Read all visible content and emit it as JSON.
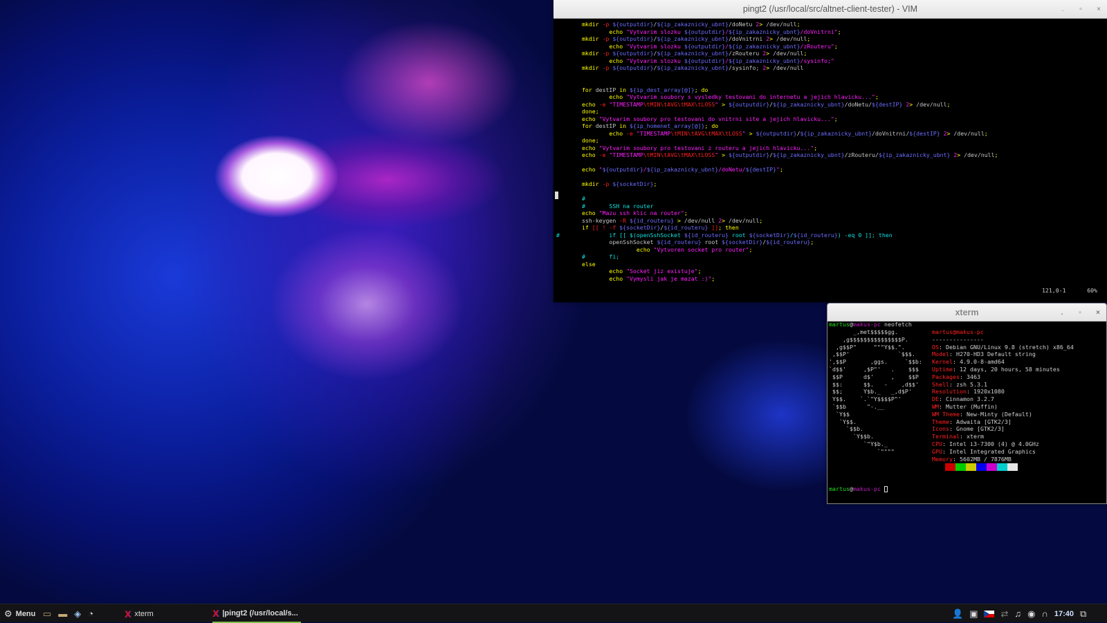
{
  "colors": {
    "y": "#ffff00",
    "r": "#ff2020",
    "m": "#ff20ff",
    "b": "#6c6cff",
    "w": "#c8c8c8",
    "c": "#10e0e0"
  },
  "vim": {
    "title": "pingt2 (/usr/local/src/altnet-client-tester) - VIM",
    "buttons": {
      "minimize": ".",
      "maximize": "▫",
      "close": "×"
    },
    "status_position": "121,0-1",
    "status_percent": "60%",
    "lines": [
      {
        "s": "",
        "t": [
          [
            "y",
            "mkdir "
          ],
          [
            "r",
            "-p "
          ],
          [
            "b",
            "${outputdir}"
          ],
          [
            "w",
            "/"
          ],
          [
            "b",
            "${ip_zakaznicky_ubnt}"
          ],
          [
            "w",
            "/doNetu "
          ],
          [
            "m",
            "2"
          ],
          [
            "y",
            ">"
          ],
          [
            "w",
            " /dev/null"
          ],
          [
            "y",
            ";"
          ]
        ]
      },
      {
        "s": "",
        "t": [
          [
            "y",
            "        echo "
          ],
          [
            "m",
            "\"Vytvarim slozku "
          ],
          [
            "b",
            "${outputdir}"
          ],
          [
            "m",
            "/"
          ],
          [
            "b",
            "${ip_zakaznicky_ubnt}"
          ],
          [
            "m",
            "/doVnitrni\""
          ],
          [
            "y",
            ";"
          ]
        ]
      },
      {
        "s": "",
        "t": [
          [
            "y",
            "mkdir "
          ],
          [
            "r",
            "-p "
          ],
          [
            "b",
            "${outputdir}"
          ],
          [
            "w",
            "/"
          ],
          [
            "b",
            "${ip_zakaznicky_ubnt}"
          ],
          [
            "w",
            "/doVnitrni "
          ],
          [
            "m",
            "2"
          ],
          [
            "y",
            ">"
          ],
          [
            "w",
            " /dev/null"
          ],
          [
            "y",
            ";"
          ]
        ]
      },
      {
        "s": "",
        "t": [
          [
            "y",
            "        echo "
          ],
          [
            "m",
            "\"Vytvarim slozku "
          ],
          [
            "b",
            "${outputdir}"
          ],
          [
            "m",
            "/"
          ],
          [
            "b",
            "${ip_zakaznicky_ubnt}"
          ],
          [
            "m",
            "/zRouteru\""
          ],
          [
            "y",
            ";"
          ]
        ]
      },
      {
        "s": "",
        "t": [
          [
            "y",
            "mkdir "
          ],
          [
            "r",
            "-p "
          ],
          [
            "b",
            "${outputdir}"
          ],
          [
            "w",
            "/"
          ],
          [
            "b",
            "${ip_zakaznicky_ubnt}"
          ],
          [
            "w",
            "/zRouteru "
          ],
          [
            "m",
            "2"
          ],
          [
            "y",
            ">"
          ],
          [
            "w",
            " /dev/null"
          ],
          [
            "y",
            ";"
          ]
        ]
      },
      {
        "s": "",
        "t": [
          [
            "y",
            "        echo "
          ],
          [
            "m",
            "\"Vytvarim slozku "
          ],
          [
            "b",
            "${outputdir}"
          ],
          [
            "m",
            "/"
          ],
          [
            "b",
            "${ip_zakaznicky_ubnt}"
          ],
          [
            "m",
            "/sysinfo;\""
          ]
        ]
      },
      {
        "s": "",
        "t": [
          [
            "y",
            "mkdir "
          ],
          [
            "r",
            "-p "
          ],
          [
            "b",
            "${outputdir}"
          ],
          [
            "w",
            "/"
          ],
          [
            "b",
            "${ip_zakaznicky_ubnt}"
          ],
          [
            "w",
            "/sysinfo; "
          ],
          [
            "m",
            "2"
          ],
          [
            "y",
            ">"
          ],
          [
            "w",
            " /dev/null"
          ]
        ]
      },
      {
        "s": "",
        "t": []
      },
      {
        "s": "",
        "t": []
      },
      {
        "s": "",
        "t": [
          [
            "y",
            "for "
          ],
          [
            "w",
            "destIP "
          ],
          [
            "y",
            "in "
          ],
          [
            "b",
            "${ip_dest_array[@]}"
          ],
          [
            "y",
            "; do"
          ]
        ]
      },
      {
        "s": "",
        "t": [
          [
            "y",
            "        echo "
          ],
          [
            "m",
            "\"Vytvarim soubory s vysledky testovani do internetu a jejich hlavicku...\""
          ],
          [
            "y",
            ";"
          ]
        ]
      },
      {
        "s": "",
        "t": [
          [
            "y",
            "echo "
          ],
          [
            "r",
            "-e "
          ],
          [
            "m",
            "\"TIMESTAMP"
          ],
          [
            "r",
            "\\tMIN\\tAVG\\tMAX\\tLOSS"
          ],
          [
            "m",
            "\""
          ],
          [
            "y",
            " > "
          ],
          [
            "b",
            "${outputdir}"
          ],
          [
            "w",
            "/"
          ],
          [
            "b",
            "${ip_zakaznicky_ubnt}"
          ],
          [
            "w",
            "/doNetu/"
          ],
          [
            "b",
            "${destIP}"
          ],
          [
            "m",
            " 2"
          ],
          [
            "y",
            ">"
          ],
          [
            "w",
            " /dev/null"
          ],
          [
            "y",
            ";"
          ]
        ]
      },
      {
        "s": "",
        "t": [
          [
            "y",
            "done;"
          ]
        ]
      },
      {
        "s": "",
        "t": [
          [
            "y",
            "echo "
          ],
          [
            "m",
            "\"Vytvarim soubory pro testovani do vnitrni site a jejich hlavicku...\""
          ],
          [
            "y",
            ";"
          ]
        ]
      },
      {
        "s": "",
        "t": [
          [
            "y",
            "for "
          ],
          [
            "w",
            "destIP "
          ],
          [
            "y",
            "in "
          ],
          [
            "b",
            "${ip_homenet_array[@]}"
          ],
          [
            "y",
            "; do"
          ]
        ]
      },
      {
        "s": "",
        "t": [
          [
            "y",
            "        echo "
          ],
          [
            "r",
            "-e "
          ],
          [
            "m",
            "\"TIMESTAMP"
          ],
          [
            "r",
            "\\tMIN\\tAVG\\tMAX\\tLOSS"
          ],
          [
            "m",
            "\""
          ],
          [
            "y",
            " > "
          ],
          [
            "b",
            "${outputdir}"
          ],
          [
            "w",
            "/"
          ],
          [
            "b",
            "${ip_zakaznicky_ubnt}"
          ],
          [
            "w",
            "/doVnitrni/"
          ],
          [
            "b",
            "${destIP}"
          ],
          [
            "m",
            " 2"
          ],
          [
            "y",
            ">"
          ],
          [
            "w",
            " /dev/null"
          ],
          [
            "y",
            ";"
          ]
        ]
      },
      {
        "s": "",
        "t": [
          [
            "y",
            "done;"
          ]
        ]
      },
      {
        "s": "",
        "t": [
          [
            "y",
            "echo "
          ],
          [
            "m",
            "\"Vytvarim soubory pro testovani z routeru a jejich hlavicku...\""
          ],
          [
            "y",
            ";"
          ]
        ]
      },
      {
        "s": "",
        "t": [
          [
            "y",
            "echo "
          ],
          [
            "r",
            "-e "
          ],
          [
            "m",
            "\"TIMESTAMP"
          ],
          [
            "r",
            "\\tMIN\\tAVG\\tMAX\\tLOSS"
          ],
          [
            "m",
            "\""
          ],
          [
            "y",
            " > "
          ],
          [
            "b",
            "${outputdir}"
          ],
          [
            "w",
            "/"
          ],
          [
            "b",
            "${ip_zakaznicky_ubnt}"
          ],
          [
            "w",
            "/zRouteru/"
          ],
          [
            "b",
            "${ip_zakaznicky_ubnt}"
          ],
          [
            "m",
            " 2"
          ],
          [
            "y",
            ">"
          ],
          [
            "w",
            " /dev/null"
          ],
          [
            "y",
            ";"
          ]
        ]
      },
      {
        "s": "",
        "t": []
      },
      {
        "s": "",
        "t": [
          [
            "y",
            "echo "
          ],
          [
            "m",
            "\""
          ],
          [
            "b",
            "${outputdir}"
          ],
          [
            "m",
            "/"
          ],
          [
            "b",
            "${ip_zakaznicky_ubnt}"
          ],
          [
            "m",
            "/doNetu/"
          ],
          [
            "b",
            "${destIP}"
          ],
          [
            "m",
            "\""
          ],
          [
            "y",
            ";"
          ]
        ]
      },
      {
        "s": "",
        "t": []
      },
      {
        "s": "",
        "t": [
          [
            "y",
            "mkdir "
          ],
          [
            "r",
            "-p "
          ],
          [
            "b",
            "${socketDir}"
          ],
          [
            "y",
            ";"
          ]
        ]
      },
      {
        "s": "",
        "t": []
      },
      {
        "s": "",
        "t": [
          [
            "c",
            "#"
          ]
        ]
      },
      {
        "s": "",
        "t": [
          [
            "c",
            "#       SSH na router"
          ]
        ]
      },
      {
        "s": "",
        "t": [
          [
            "y",
            "echo "
          ],
          [
            "m",
            "\"Mazu ssh klic na router\""
          ],
          [
            "y",
            ";"
          ]
        ]
      },
      {
        "s": "",
        "t": [
          [
            "w",
            "ssh-keygen "
          ],
          [
            "r",
            "-R "
          ],
          [
            "b",
            "${id_routeru}"
          ],
          [
            "y",
            " > "
          ],
          [
            "w",
            "/dev/null "
          ],
          [
            "m",
            "2"
          ],
          [
            "y",
            ">"
          ],
          [
            "w",
            " /dev/null"
          ],
          [
            "y",
            ";"
          ]
        ]
      },
      {
        "s": "",
        "t": [
          [
            "y",
            "if "
          ],
          [
            "r",
            "[[ ! -f "
          ],
          [
            "b",
            "${socketDir}"
          ],
          [
            "w",
            "/"
          ],
          [
            "b",
            "${id_routeru}"
          ],
          [
            "r",
            " ]]"
          ],
          [
            "y",
            "; then"
          ]
        ]
      },
      {
        "s": "#",
        "t": [
          [
            "c",
            "        if [[ $(openSshSocket "
          ],
          [
            "b",
            "${id_routeru}"
          ],
          [
            "c",
            " root "
          ],
          [
            "b",
            "${socketDir}"
          ],
          [
            "c",
            "/"
          ],
          [
            "b",
            "${id_routeru}"
          ],
          [
            "c",
            ") -eq 0 ]]; then"
          ]
        ]
      },
      {
        "s": "",
        "t": [
          [
            "w",
            "        openSshSocket "
          ],
          [
            "b",
            "${id_routeru}"
          ],
          [
            "w",
            " root "
          ],
          [
            "b",
            "${socketDir}"
          ],
          [
            "w",
            "/"
          ],
          [
            "b",
            "${id_routeru}"
          ],
          [
            "y",
            ";"
          ]
        ]
      },
      {
        "s": "",
        "t": [
          [
            "y",
            "                echo "
          ],
          [
            "m",
            "\"Vytvoren socket pro router\""
          ],
          [
            "y",
            ";"
          ]
        ]
      },
      {
        "s": "",
        "t": [
          [
            "c",
            "#       fi;"
          ]
        ]
      },
      {
        "s": "",
        "t": [
          [
            "y",
            "else"
          ]
        ]
      },
      {
        "s": "",
        "t": [
          [
            "y",
            "        echo "
          ],
          [
            "m",
            "\"Socket jiz existuje\""
          ],
          [
            "y",
            ";"
          ]
        ]
      },
      {
        "s": "",
        "t": [
          [
            "y",
            "        echo "
          ],
          [
            "m",
            "\"Vymysli jak je mazat :)\""
          ],
          [
            "y",
            ";"
          ]
        ]
      }
    ]
  },
  "xterm": {
    "title": "xterm",
    "buttons": {
      "minimize": ".",
      "maximize": "▫",
      "close": "×"
    },
    "prompt_user": "martus",
    "prompt_at": "@",
    "prompt_host": "makus-pc",
    "command": " neofetch",
    "logo": [
      "       _,met$$$$$gg.",
      "    ,g$$$$$$$$$$$$$$$P.",
      "  ,g$$P\"     \"\"\"Y$$.\".",
      " ,$$P'              `$$$.",
      "',$$P       ,ggs.     `$$b:",
      "`d$$'     ,$P\"'   .    $$$",
      " $$P      d$'     ,    $$P",
      " $$:      $$.   -    ,d$$'",
      " $$;      Y$b._   _,d$P'",
      " Y$$.    `.`\"Y$$$$P\"'",
      " `$$b      \"-.__",
      "  `Y$$",
      "   `Y$$.",
      "     `$$b.",
      "       `Y$$b.",
      "          `\"Y$b._",
      "              `\"\"\"\""
    ],
    "info_title": "martus@makus-pc",
    "info_sep": "---------------",
    "info": [
      {
        "k": "OS",
        "v": "Debian GNU/Linux 9.8 (stretch) x86_64"
      },
      {
        "k": "Model",
        "v": "H270-HD3 Default string"
      },
      {
        "k": "Kernel",
        "v": "4.9.0-8-amd64"
      },
      {
        "k": "Uptime",
        "v": "12 days, 20 hours, 58 minutes"
      },
      {
        "k": "Packages",
        "v": "3463"
      },
      {
        "k": "Shell",
        "v": "zsh 5.3.1"
      },
      {
        "k": "Resolution",
        "v": "1920x1080"
      },
      {
        "k": "DE",
        "v": "Cinnamon 3.2.7"
      },
      {
        "k": "WM",
        "v": "Mutter (Muffin)"
      },
      {
        "k": "WM Theme",
        "v": "New-Minty (Default)"
      },
      {
        "k": "Theme",
        "v": "Adwaita [GTK2/3]"
      },
      {
        "k": "Icons",
        "v": "Gnome [GTK2/3]"
      },
      {
        "k": "Terminal",
        "v": "xterm"
      },
      {
        "k": "CPU",
        "v": "Intel i3-7300 (4) @ 4.0GHz"
      },
      {
        "k": "GPU",
        "v": "Intel Integrated Graphics"
      },
      {
        "k": "Memory",
        "v": "5602MB / 7876MB"
      }
    ],
    "palette": [
      "#cc0000",
      "#00cc00",
      "#cccc00",
      "#0000ee",
      "#cc00cc",
      "#00cccc",
      "#e5e5e5"
    ]
  },
  "taskbar": {
    "menu_label": "Menu",
    "launchers": [
      {
        "name": "home-folder-icon"
      },
      {
        "name": "file-manager-icon"
      },
      {
        "name": "package-icon"
      },
      {
        "name": "clock-app-icon"
      }
    ],
    "tasks": [
      {
        "label": "xterm",
        "active": false
      },
      {
        "label": "|pingt2 (/usr/local/s...",
        "active": true
      }
    ],
    "clock": "17:40",
    "tray": [
      "user-icon",
      "clipboard-icon",
      "czech-flag-icon",
      "network-disconnected-icon",
      "music-icon",
      "update-icon",
      "headphones-icon"
    ]
  }
}
